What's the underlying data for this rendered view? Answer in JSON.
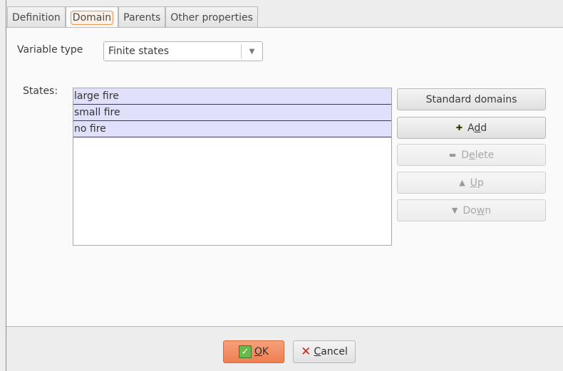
{
  "tabs": [
    {
      "label": "Definition"
    },
    {
      "label": "Domain"
    },
    {
      "label": "Parents"
    },
    {
      "label": "Other properties"
    }
  ],
  "active_tab": "Domain",
  "variable_type": {
    "label": "Variable type",
    "value": "Finite states"
  },
  "states": {
    "label": "States:",
    "items": [
      "large fire",
      "small fire",
      "no fire"
    ]
  },
  "buttons": {
    "standard_domains": "Standard domains",
    "add": {
      "pre": "A",
      "ul": "d",
      "post": "d",
      "icon": "plus-icon",
      "enabled": true
    },
    "delete": {
      "pre": "D",
      "ul": "e",
      "post": "lete",
      "icon": "minus-icon",
      "enabled": false
    },
    "up": {
      "pre": "",
      "ul": "U",
      "post": "p",
      "icon": "arrow-up-icon",
      "enabled": false
    },
    "down": {
      "pre": "Do",
      "ul": "w",
      "post": "n",
      "icon": "arrow-down-icon",
      "enabled": false
    }
  },
  "footer": {
    "ok": {
      "ul": "O",
      "post": "K"
    },
    "cancel": {
      "ul": "C",
      "post": "ancel"
    }
  },
  "colors": {
    "accent": "#ee7e52",
    "selection": "#e0e0fa"
  }
}
